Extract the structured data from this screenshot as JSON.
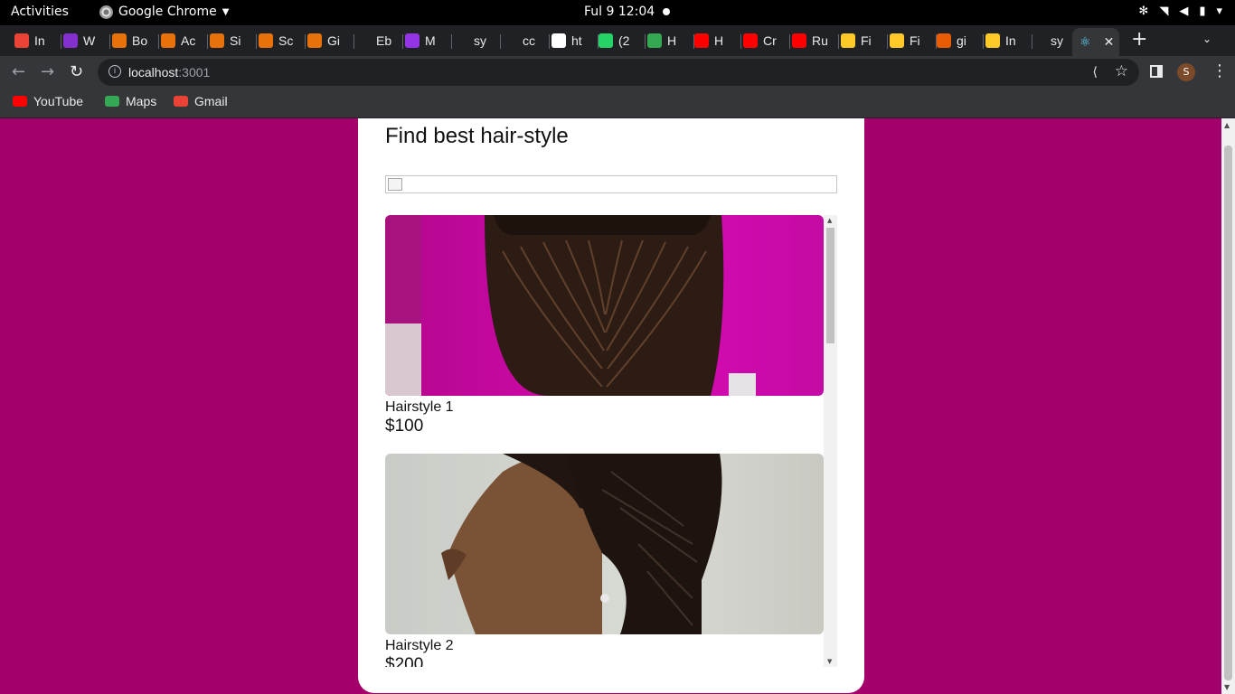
{
  "system": {
    "activities": "Activities",
    "app_name": "Google Chrome",
    "clock": "Ful 9  12:04"
  },
  "tabs": [
    {
      "label": "In",
      "color": "#ea4335"
    },
    {
      "label": "W",
      "color": "#8430ce"
    },
    {
      "label": "Bo",
      "color": "#e8710a"
    },
    {
      "label": "Ac",
      "color": "#e8710a"
    },
    {
      "label": "Si",
      "color": "#e8710a"
    },
    {
      "label": "Sc",
      "color": "#e8710a"
    },
    {
      "label": "Gi",
      "color": "#e8710a"
    },
    {
      "label": "Eb",
      "color": "#202124"
    },
    {
      "label": "M",
      "color": "#9334e6"
    },
    {
      "label": "sy",
      "color": "#202124"
    },
    {
      "label": "cc",
      "color": "#202124"
    },
    {
      "label": "ht",
      "color": "#ffffff"
    },
    {
      "label": "(2",
      "color": "#25d366"
    },
    {
      "label": "H",
      "color": "#34a853"
    },
    {
      "label": "H",
      "color": "#ff0000"
    },
    {
      "label": "Cr",
      "color": "#ff0000"
    },
    {
      "label": "Ru",
      "color": "#ff0000"
    },
    {
      "label": "Fi",
      "color": "#ffca28"
    },
    {
      "label": "Fi",
      "color": "#ffca28"
    },
    {
      "label": "gi",
      "color": "#e85d04"
    },
    {
      "label": "In",
      "color": "#ffca28"
    },
    {
      "label": "sy",
      "color": "#202124"
    }
  ],
  "active_tab": {
    "close": "✕"
  },
  "toolbar": {
    "url_host": "localhost",
    "url_port": ":3001",
    "profile_initial": "S"
  },
  "bookmarks": [
    {
      "label": "YouTube",
      "color": "#ff0000"
    },
    {
      "label": "Maps",
      "color": "#34a853"
    },
    {
      "label": "Gmail",
      "color": "#ea4335"
    }
  ],
  "page": {
    "title": "Find best hair-style",
    "items": [
      {
        "name": "Hairstyle 1",
        "price": "$100"
      },
      {
        "name": "Hairstyle 2",
        "price": "$200"
      }
    ]
  },
  "colors": {
    "page_background": "#a3006b",
    "card_background": "#ffffff"
  }
}
